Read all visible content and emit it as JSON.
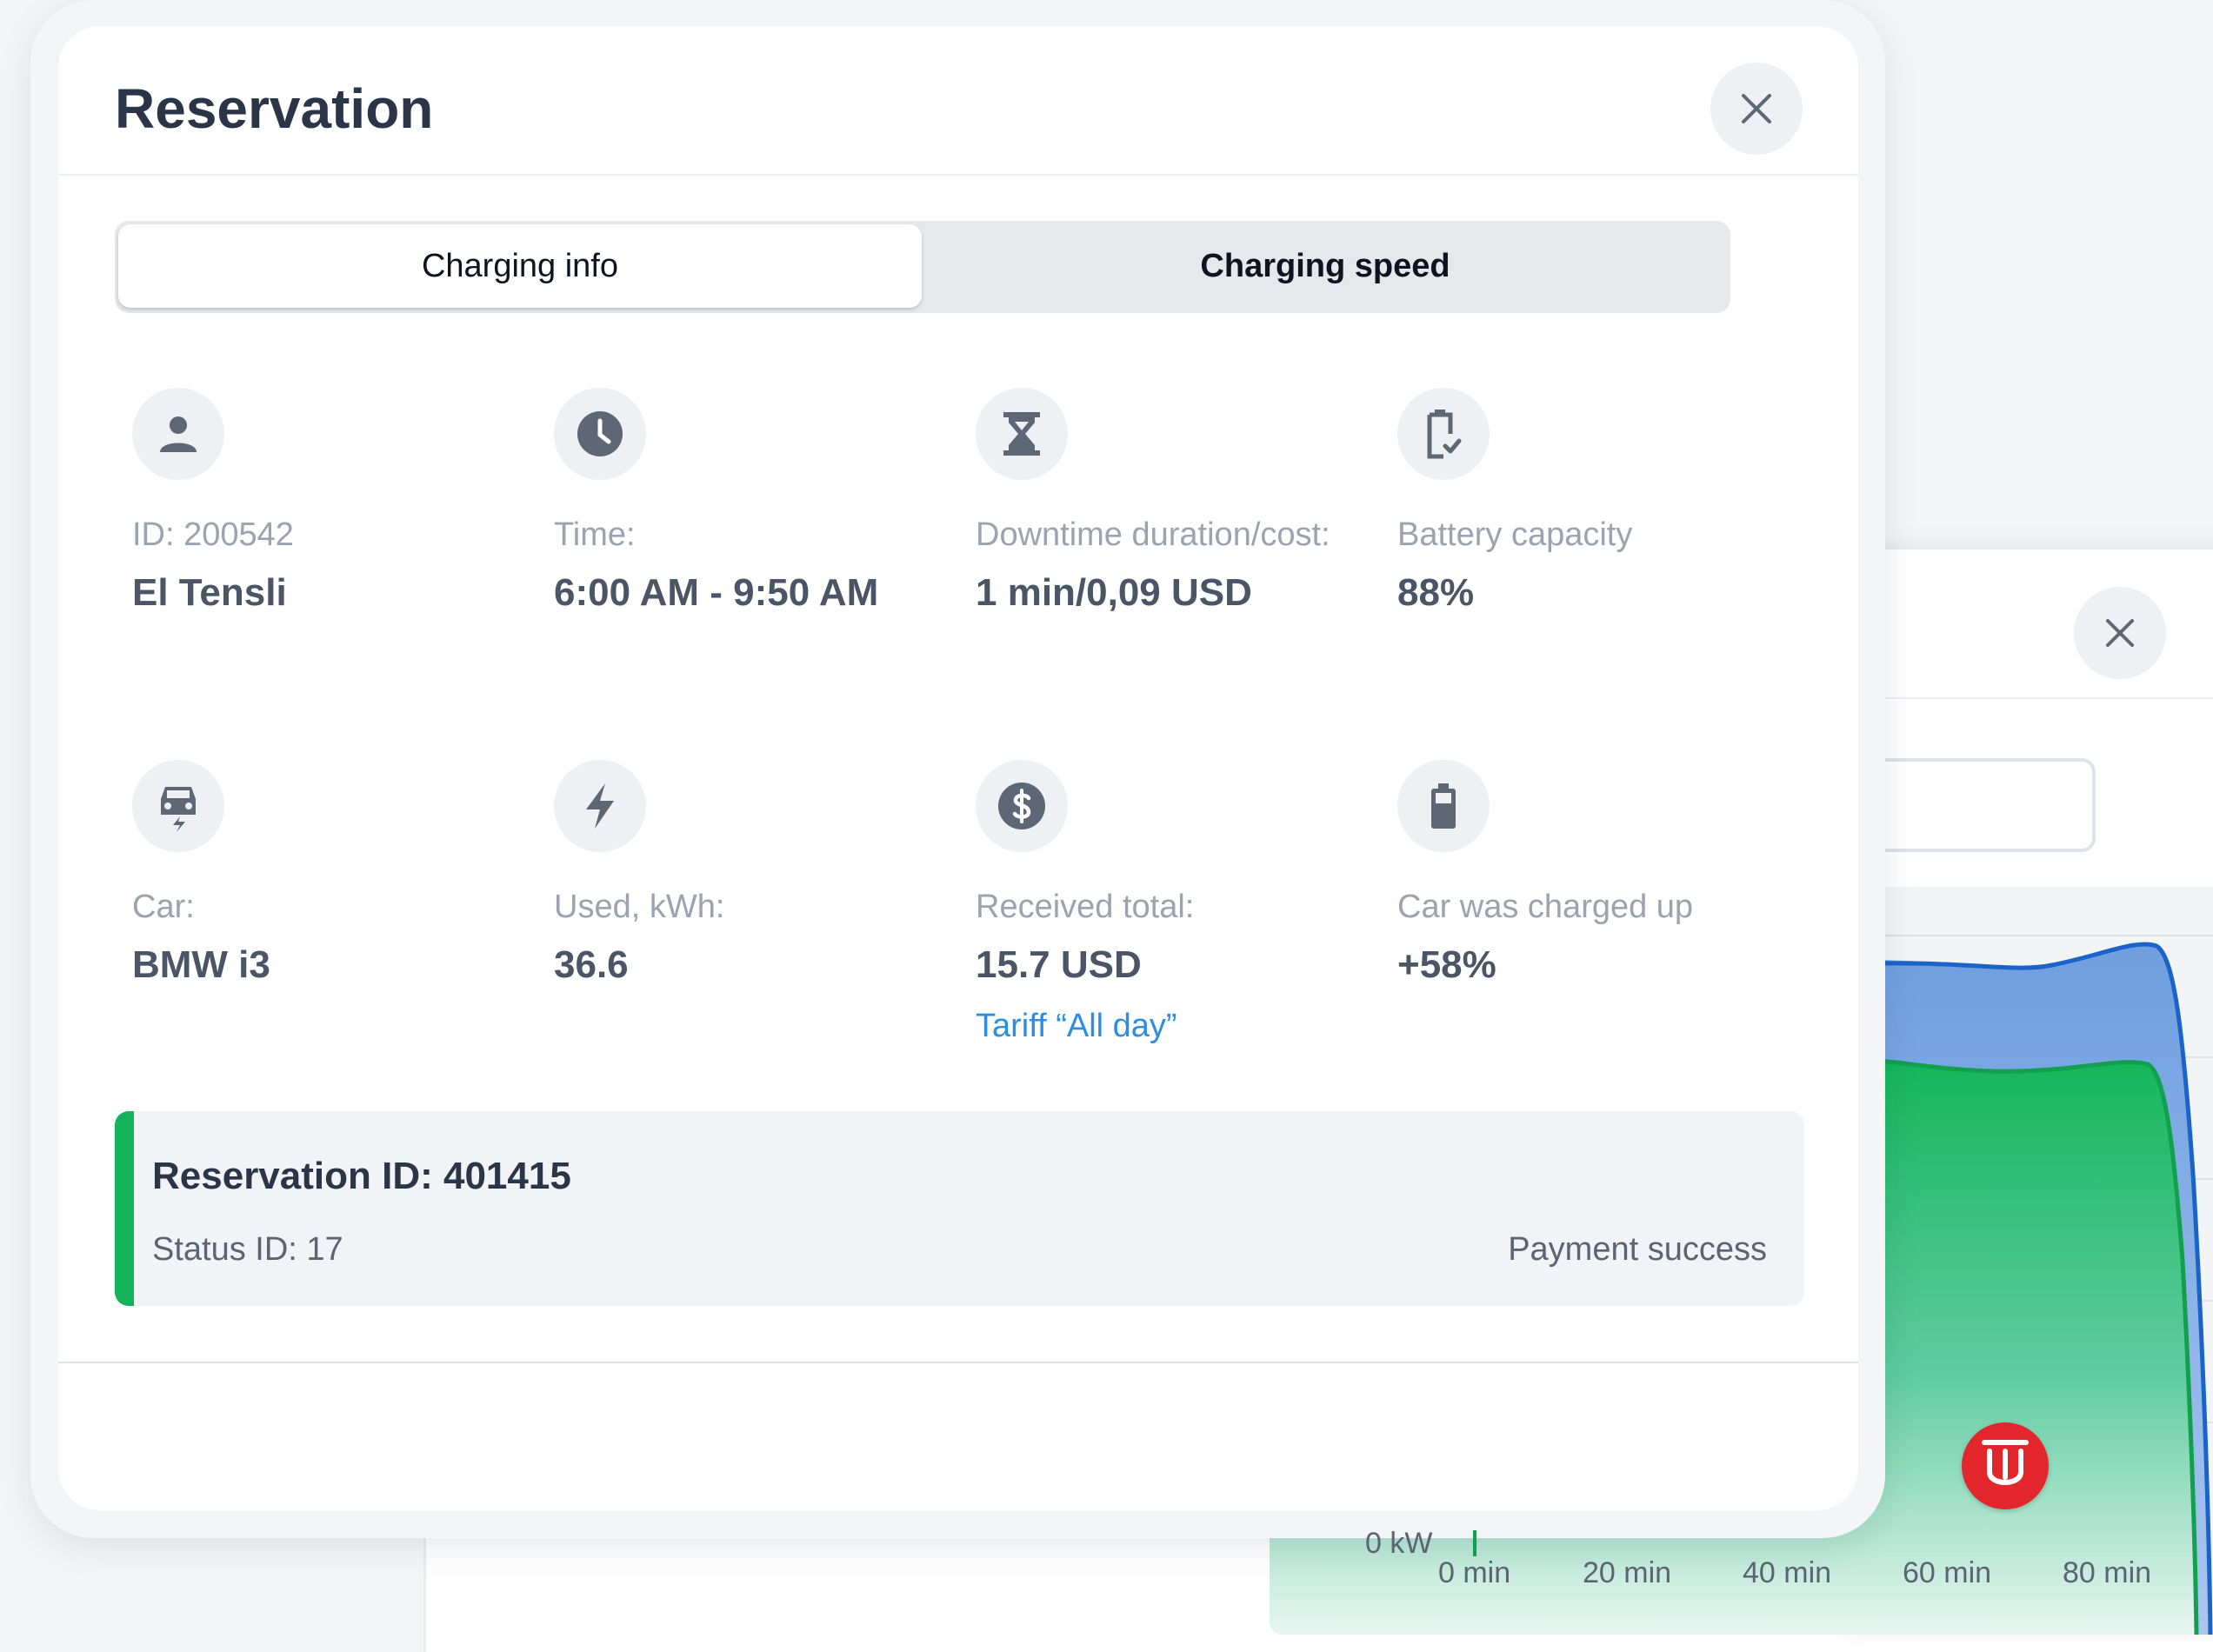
{
  "modal": {
    "title": "Reservation",
    "close_label": "×"
  },
  "tabs": [
    {
      "label": "Charging info",
      "active": true
    },
    {
      "label": "Charging speed",
      "active": false
    }
  ],
  "info": [
    {
      "icon": "user-icon",
      "label": "ID: 200542",
      "value": "El Tensli"
    },
    {
      "icon": "clock-icon",
      "label": "Time:",
      "value": "6:00 AM - 9:50 AM"
    },
    {
      "icon": "hourglass-icon",
      "label": "Downtime duration/cost:",
      "value": "1 min/0,09 USD"
    },
    {
      "icon": "battery-check-icon",
      "label": "Battery capacity",
      "value": "88%"
    },
    {
      "icon": "car-charging-icon",
      "label": "Car:",
      "value": "BMW i3"
    },
    {
      "icon": "lightning-icon",
      "label": "Used, kWh:",
      "value": "36.6"
    },
    {
      "icon": "dollar-icon",
      "label": "Received total:",
      "value": "15.7 USD",
      "link": "Tariff “All day”"
    },
    {
      "icon": "battery-icon",
      "label": "Car was charged up",
      "value": "+58%"
    }
  ],
  "reservation": {
    "id_text": "Reservation ID: 401415",
    "status_text": "Status ID: 17",
    "payment_text": "Payment success",
    "accent_color": "#12b359"
  },
  "colors": {
    "title": "#2a3547",
    "label": "#9aa3af",
    "value": "#4a5566",
    "link": "#2b8ee0",
    "chart_blue": "#1b63c9",
    "chart_green": "#12a04f",
    "logo_red": "#e3262b"
  },
  "background_chart": {
    "y_tick": "0 kW",
    "x_ticks": [
      "0 min",
      "20 min",
      "40 min",
      "60 min",
      "80 min"
    ],
    "logo_letter": "U"
  }
}
